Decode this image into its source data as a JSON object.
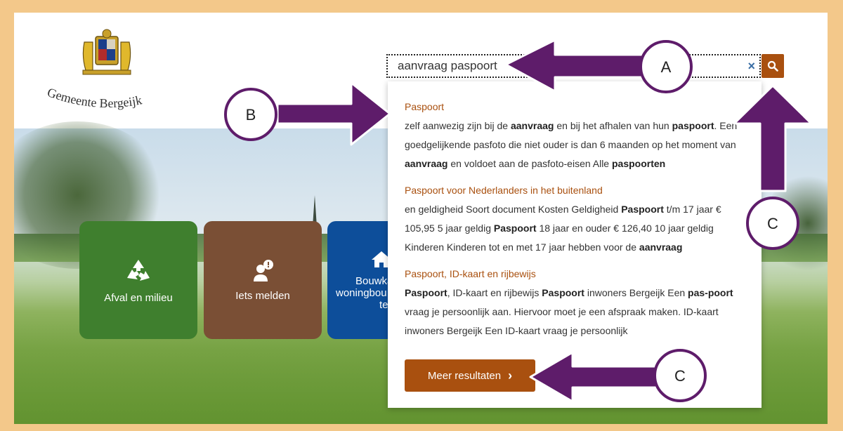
{
  "header": {
    "logo_text": "Gemeente Bergeijk"
  },
  "search": {
    "value": "aanvraag paspoort",
    "clear_label": "×"
  },
  "tiles": [
    {
      "label": "Afval en milieu"
    },
    {
      "label": "Iets melden"
    },
    {
      "label_line1": "Bouwka",
      "label_line2": "woningbou",
      "label_line3": "te"
    }
  ],
  "results": [
    {
      "title": "Paspoort",
      "snippet_html": "zelf aanwezig zijn bij de <b>aanvraag</b> en bij het afhalen van hun <b>paspoort</b>. Een goedgelijkende pasfoto die niet ouder is dan 6 maanden op het moment van <b>aanvraag</b> en voldoet aan de pasfoto-eisen Alle <b>paspoorten</b>"
    },
    {
      "title": "Paspoort voor Nederlanders in het buitenland",
      "snippet_html": "en geldigheid Soort document Kosten Geldigheid <b>Paspoort</b> t/m 17 jaar € 105,95 5 jaar geldig <b>Paspoort</b> 18 jaar en ouder € 126,40 10 jaar geldig Kinderen Kinderen tot en met 17 jaar hebben voor de <b>aanvraag</b>"
    },
    {
      "title": "Paspoort, ID-kaart en rijbewijs",
      "snippet_html": "<b>Paspoort</b>, ID-kaart en rijbewijs <b>Paspoort</b> inwoners Bergeijk Een <b>pas-poort</b> vraag je persoonlijk aan. Hiervoor moet je een afspraak maken. ID-kaart inwoners Bergeijk Een ID-kaart vraag je persoonlijk"
    }
  ],
  "more_button": {
    "label": "Meer resultaten",
    "chevron": "›"
  },
  "annotations": {
    "a": "A",
    "b": "B",
    "c1": "C",
    "c2": "C"
  },
  "colors": {
    "accent": "#a9500f",
    "annotation_arrow": "#5e1c6a",
    "frame": "#f3c88a"
  }
}
